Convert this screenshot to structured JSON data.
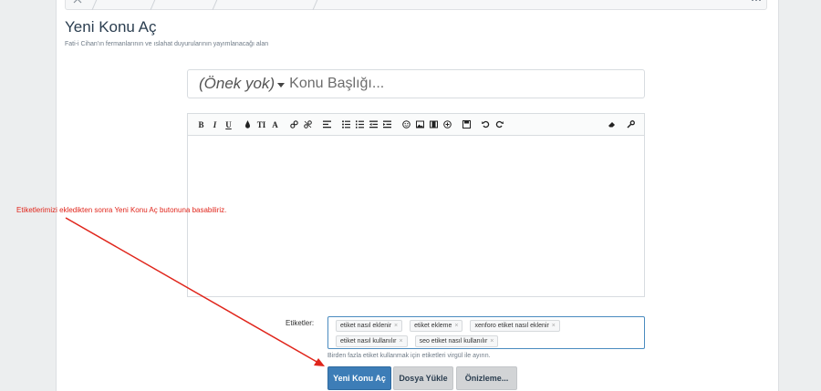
{
  "header": {
    "title": "Yeni Konu Aç",
    "subtitle": "Fati-i Cihan'ın fermanlarının ve ıslahat duyurularının yayımlanacağı alan"
  },
  "thread_title": {
    "prefix": "(Önek yok)",
    "placeholder": "Konu Başlığı..."
  },
  "toolbar_icons": [
    "bold-icon",
    "italic-icon",
    "underline-icon",
    "text-color-icon",
    "font-size-icon",
    "font-family-icon",
    "link-icon",
    "unlink-icon",
    "align-icon",
    "bullet-list-icon",
    "number-list-icon",
    "outdent-icon",
    "indent-icon",
    "smiley-icon",
    "image-icon",
    "media-icon",
    "insert-icon",
    "save-draft-icon",
    "undo-icon",
    "redo-icon",
    "remove-format-icon",
    "toggle-bbcode-icon"
  ],
  "toolbar": {
    "bold": "B",
    "italic": "I",
    "underline": "U",
    "font_size": "TI",
    "font_family": "A"
  },
  "tags": {
    "label": "Etiketler:",
    "row1": [
      "etiket nasıl eklenir",
      "etiket ekleme",
      "xenforo etiket nasıl eklenir"
    ],
    "row2": [
      "etiket nasıl kullanılır",
      "seo etiket nasıl kullanılır"
    ],
    "remove_glyph": "×",
    "hint": "Birden fazla etiket kullanmak için etiketleri virgül ile ayırın."
  },
  "buttons": {
    "submit": "Yeni Konu Aç",
    "upload": "Dosya Yükle",
    "preview": "Önizleme..."
  },
  "annotation": {
    "text": "Etiketlerimizi ekledikten sonra Yeni Konu Aç butonuna basabiliriz.",
    "color": "#e0251b"
  },
  "colors": {
    "primary_button": "#3d7db7",
    "title": "#2b3e50",
    "tag_border_focus": "#4a8bbf"
  }
}
